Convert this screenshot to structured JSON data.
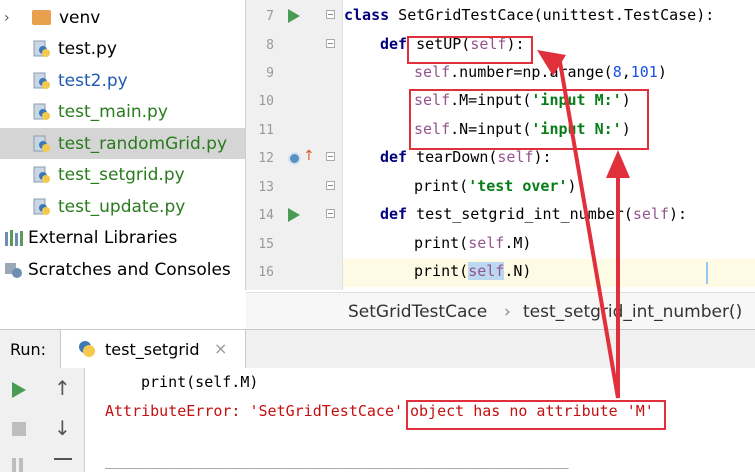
{
  "project_tree": {
    "items": [
      {
        "label": "venv",
        "type": "folder"
      },
      {
        "label": "test.py",
        "type": "py"
      },
      {
        "label": "test2.py",
        "type": "py"
      },
      {
        "label": "test_main.py",
        "type": "py"
      },
      {
        "label": "test_randomGrid.py",
        "type": "py",
        "selected": true
      },
      {
        "label": "test_setgrid.py",
        "type": "py"
      },
      {
        "label": "test_update.py",
        "type": "py"
      },
      {
        "label": "External Libraries",
        "type": "libs"
      },
      {
        "label": "Scratches and Consoles",
        "type": "scratch"
      }
    ]
  },
  "editor": {
    "line_numbers": [
      "7",
      "8",
      "9",
      "10",
      "11",
      "12",
      "13",
      "14",
      "15",
      "16"
    ],
    "l7": {
      "kw": "class",
      "name": " SetGridTestCace",
      "rest": "(unittest.TestCase):"
    },
    "l8": {
      "kw": "def",
      "name": "setUP",
      "self": "self",
      "rest": "):"
    },
    "l9": {
      "self": "self",
      "rest": ".number=np.arange(",
      "n1": "8",
      "comma": ",",
      "n2": "101",
      "close": ")"
    },
    "l10": {
      "self": "self",
      "rest": ".M=input(",
      "str": "'input M:'",
      "close": ")"
    },
    "l11": {
      "self": "self",
      "rest": ".N=input(",
      "str": "'input N:'",
      "close": ")"
    },
    "l12": {
      "kw": "def",
      "name": " tearDown(",
      "self": "self",
      "rest": "):"
    },
    "l13": {
      "rest": "print(",
      "str": "'test over'",
      "close": ")"
    },
    "l14": {
      "kw": "def",
      "name": " test_setgrid_int_number(",
      "self": "self",
      "rest": "):"
    },
    "l15": {
      "rest": "print(",
      "self": "self",
      "close": ".M)"
    },
    "l16": {
      "rest": "print(",
      "self": "self",
      "close": ".N)"
    }
  },
  "breadcrumb": {
    "class_name": "SetGridTestCace",
    "separator": "›",
    "method_name": "test_setgrid_int_number()"
  },
  "run_panel": {
    "label": "Run:",
    "tab_label": "test_setgrid",
    "close_glyph": "×"
  },
  "console": {
    "line1": "print(self.M)",
    "error_prefix": "AttributeError: 'SetGridTestCace' ",
    "error_highlight": "object has no attribute 'M'",
    "separator_line": "______________________________________________________________________"
  },
  "colors": {
    "annotation_red": "#e0303c",
    "run_green": "#499c54",
    "keyword_blue": "#000080",
    "string_green": "#067d17"
  }
}
